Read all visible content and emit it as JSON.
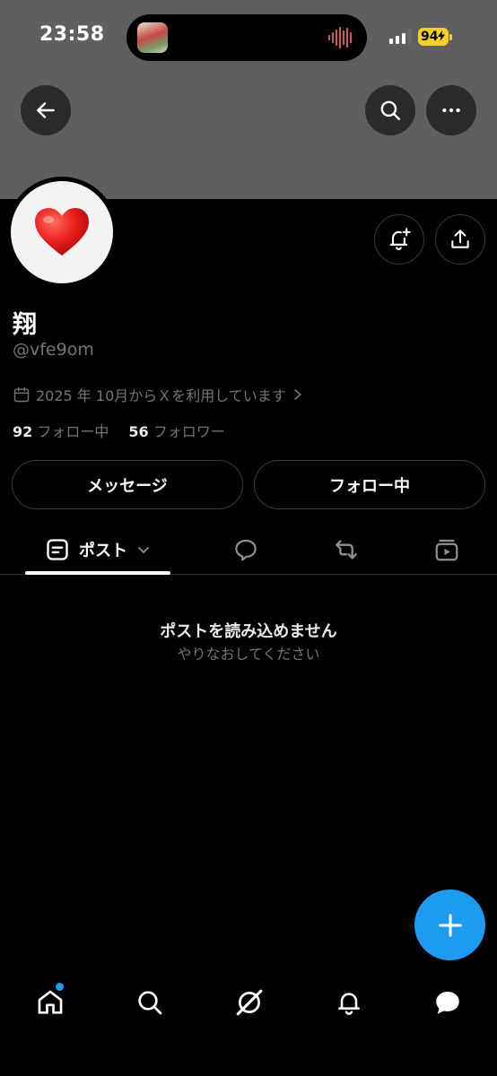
{
  "status_bar": {
    "time": "23:58",
    "battery": "94"
  },
  "header": {
    "back_icon": "arrow-left-icon",
    "search_icon": "search-icon",
    "more_icon": "more-horizontal-icon"
  },
  "profile": {
    "avatar_icon": "red-heart-icon",
    "display_name": "翔",
    "handle": "@vfe9om",
    "joined": "2025 年 10月からＸを利用しています",
    "following_count": "92",
    "following_label": "フォロー中",
    "followers_count": "56",
    "followers_label": "フォロワー"
  },
  "actions": {
    "message_label": "メッセージ",
    "following_label": "フォロー中"
  },
  "tabs": [
    {
      "label": "ポスト",
      "icon": "posts-icon",
      "active": true
    },
    {
      "label": "",
      "icon": "replies-icon",
      "active": false
    },
    {
      "label": "",
      "icon": "repost-icon",
      "active": false
    },
    {
      "label": "",
      "icon": "media-icon",
      "active": false
    }
  ],
  "empty_state": {
    "title": "ポストを読み込めません",
    "subtitle": "やりなおしてください"
  },
  "colors": {
    "accent": "#1d9bf0",
    "banner": "#5f5f5f",
    "muted_text": "#71767b",
    "battery": "#f5d02a"
  },
  "bottom_nav": [
    "home-icon",
    "search-icon",
    "grok-icon",
    "bell-icon",
    "messages-icon"
  ]
}
